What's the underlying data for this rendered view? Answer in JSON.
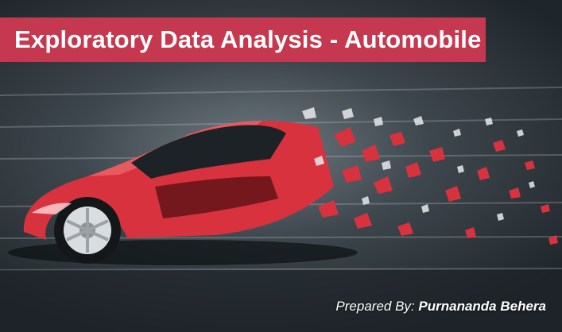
{
  "title": "Exploratory Data Analysis - Automobile",
  "credit": {
    "label": "Prepared By:",
    "author": "Purnananda Behera"
  },
  "colors": {
    "banner": "#c5384f",
    "car_body": "#d8323e",
    "background": "#4a545a"
  },
  "illustration": "red-sports-car-disintegrating-icon"
}
